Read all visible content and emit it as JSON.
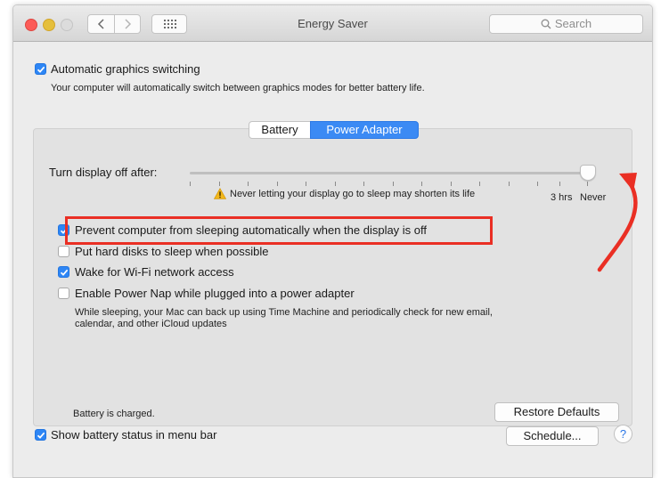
{
  "window": {
    "title": "Energy Saver"
  },
  "toolbar": {
    "search_placeholder": "Search"
  },
  "graphics": {
    "checked": true,
    "label": "Automatic graphics switching",
    "description": "Your computer will automatically switch between graphics modes for better battery life."
  },
  "tabs": [
    {
      "label": "Battery",
      "selected": false
    },
    {
      "label": "Power Adapter",
      "selected": true
    }
  ],
  "display_sleep": {
    "label": "Turn display off after:",
    "warning": "Never letting your display go to sleep may shorten its life",
    "tick_3hrs": "3 hrs",
    "tick_never": "Never",
    "slider_value": "Never"
  },
  "options": [
    {
      "label": "Prevent computer from sleeping automatically when the display is off",
      "checked": true
    },
    {
      "label": "Put hard disks to sleep when possible",
      "checked": false
    },
    {
      "label": "Wake for Wi-Fi network access",
      "checked": true
    },
    {
      "label": "Enable Power Nap while plugged into a power adapter",
      "checked": false
    }
  ],
  "power_nap_description": {
    "line1": "While sleeping, your Mac can back up using Time Machine and periodically check for new email,",
    "line2": "calendar, and other iCloud updates"
  },
  "status": {
    "battery": "Battery is charged."
  },
  "buttons": {
    "restore_defaults": "Restore Defaults",
    "schedule": "Schedule...",
    "help": "?"
  },
  "bottom": {
    "show_battery_status": "Show battery status in menu bar",
    "checked": true
  },
  "colors": {
    "accent": "#2e86f5",
    "annotation": "#ea2f24"
  }
}
